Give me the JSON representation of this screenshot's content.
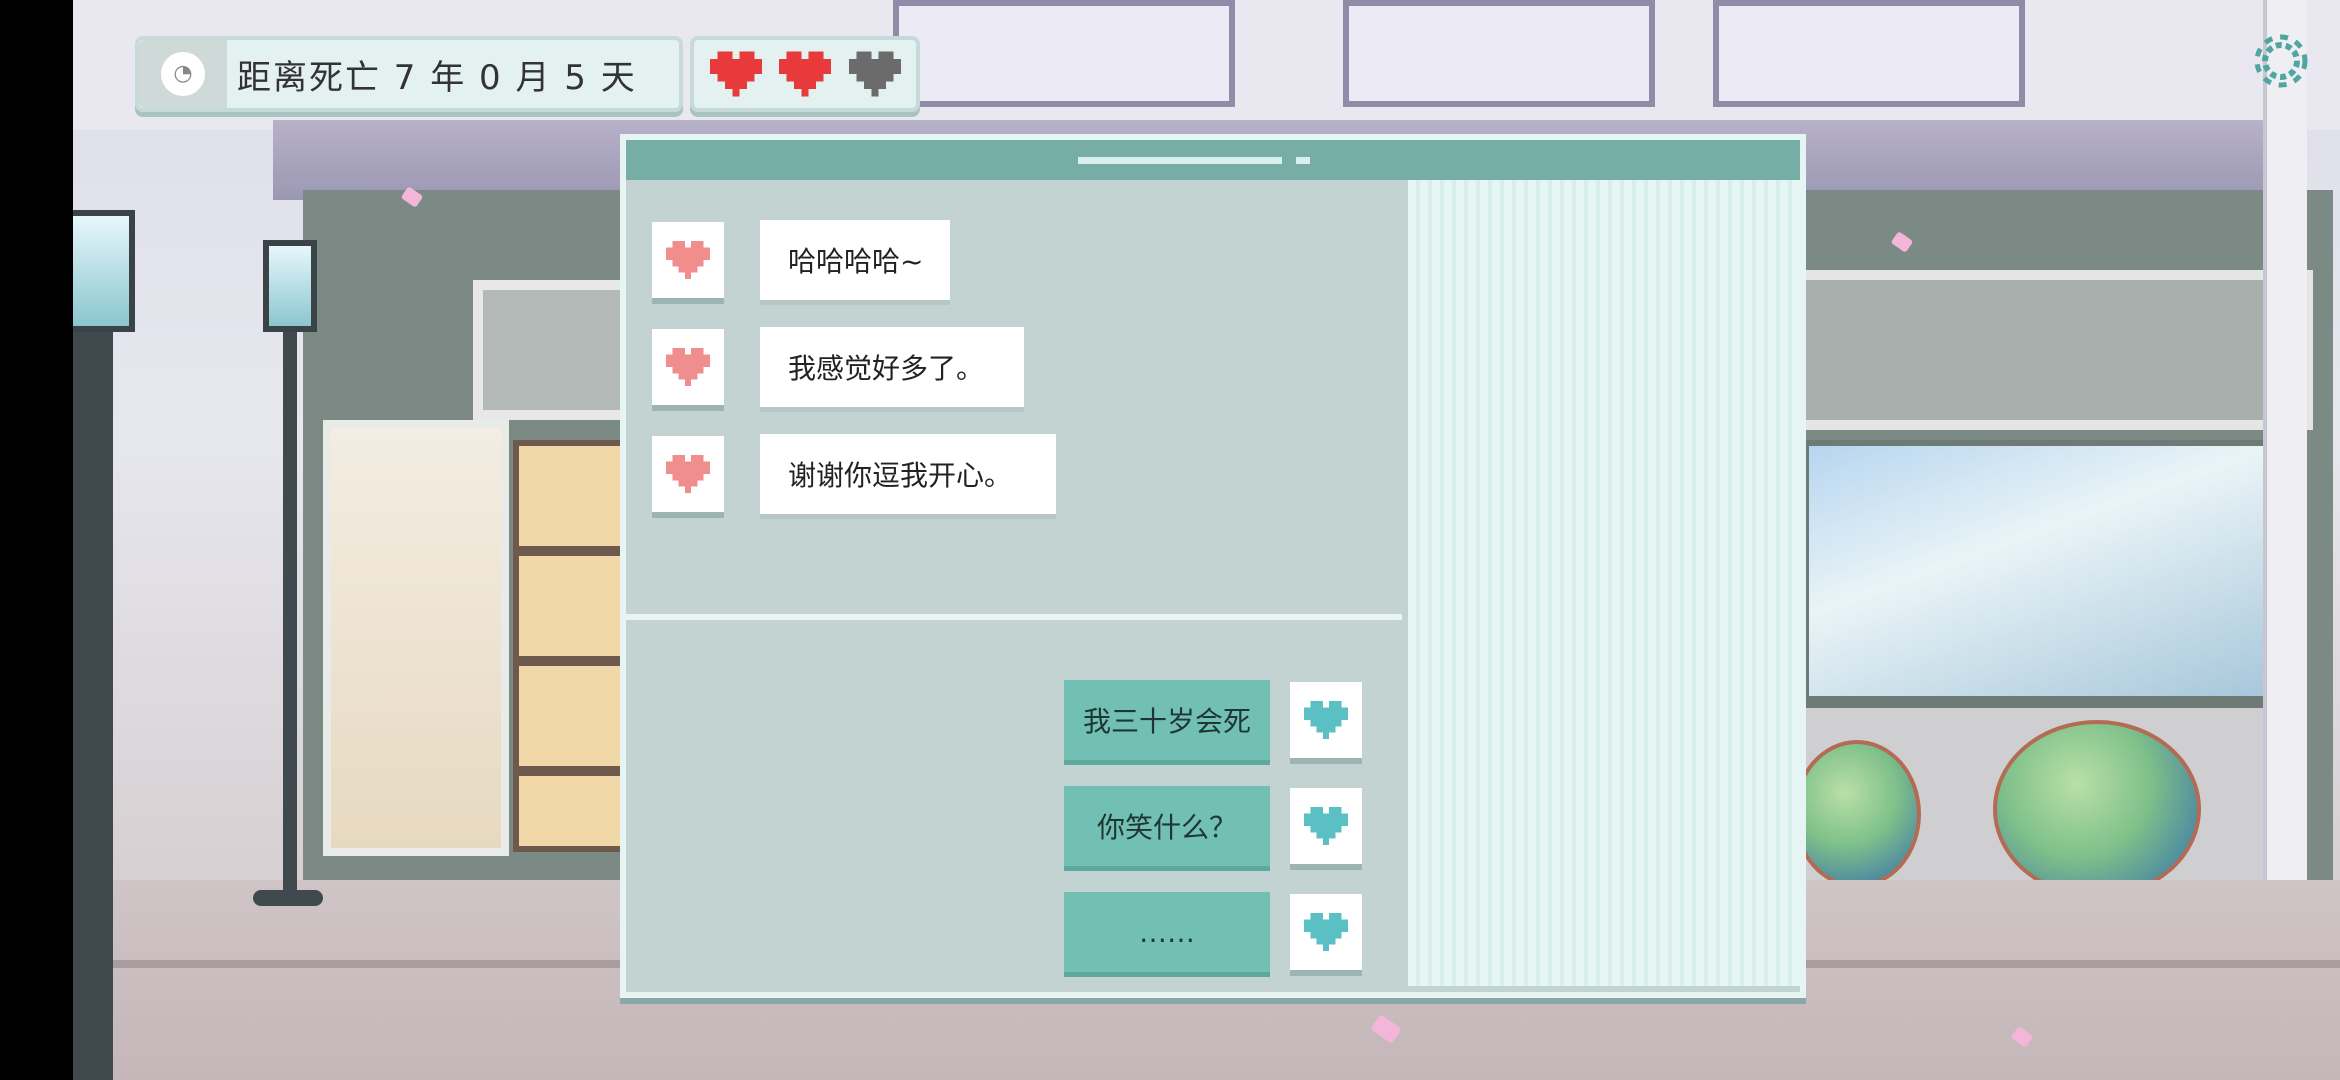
{
  "hud": {
    "countdown_text": "距离死亡 7 年 0 月 5 天",
    "clock_icon": "clock-icon",
    "lives": {
      "filled": 2,
      "total": 3,
      "filled_color": "#e8393b",
      "empty_color": "#6b6b6b"
    },
    "settings_icon": "gear-icon"
  },
  "chat": {
    "incoming": [
      {
        "text": "哈哈哈哈~",
        "avatar_icon": "heart-icon",
        "avatar_color": "#f08d8d"
      },
      {
        "text": "我感觉好多了。",
        "avatar_icon": "heart-icon",
        "avatar_color": "#f08d8d"
      },
      {
        "text": "谢谢你逗我开心。",
        "avatar_icon": "heart-icon",
        "avatar_color": "#f08d8d"
      }
    ],
    "choices": [
      {
        "text": "我三十岁会死",
        "avatar_icon": "heart-icon",
        "avatar_color": "#5bc0c4"
      },
      {
        "text": "你笑什么？",
        "avatar_icon": "heart-icon",
        "avatar_color": "#5bc0c4"
      },
      {
        "text": "……",
        "avatar_icon": "heart-icon",
        "avatar_color": "#5bc0c4"
      }
    ]
  },
  "colors": {
    "window_bg": "#c2d3d1",
    "titlebar": "#76aea5",
    "choice_bubble": "#72bfb4"
  }
}
